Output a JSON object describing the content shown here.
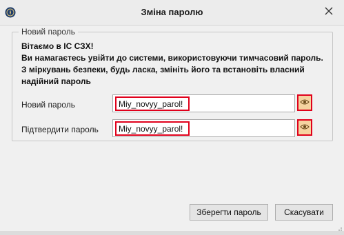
{
  "window": {
    "title": "Зміна паролю"
  },
  "group": {
    "legend": "Новий пароль",
    "welcome_line1": "Вітаємо в ІС СЗХ!",
    "welcome_line2": "Ви намагаєтесь увійти до системи, використовуючи тимчасовий пароль.",
    "welcome_line3": "З міркувань безпеки, будь ласка, змініть його та встановіть власний надійний пароль"
  },
  "fields": {
    "new_password_label": "Новий пароль",
    "new_password_value": "Miy_novyy_parol!",
    "confirm_password_label": "Підтвердити пароль",
    "confirm_password_value": "Miy_novyy_parol!"
  },
  "buttons": {
    "save_label": "Зберегти пароль",
    "cancel_label": "Скасувати"
  },
  "icons": {
    "app": "app-logo-icon",
    "close": "close-icon",
    "show_password": "eye-icon"
  },
  "colors": {
    "highlight": "#e0001b",
    "eye_button_bg": "#f6d3a0"
  }
}
